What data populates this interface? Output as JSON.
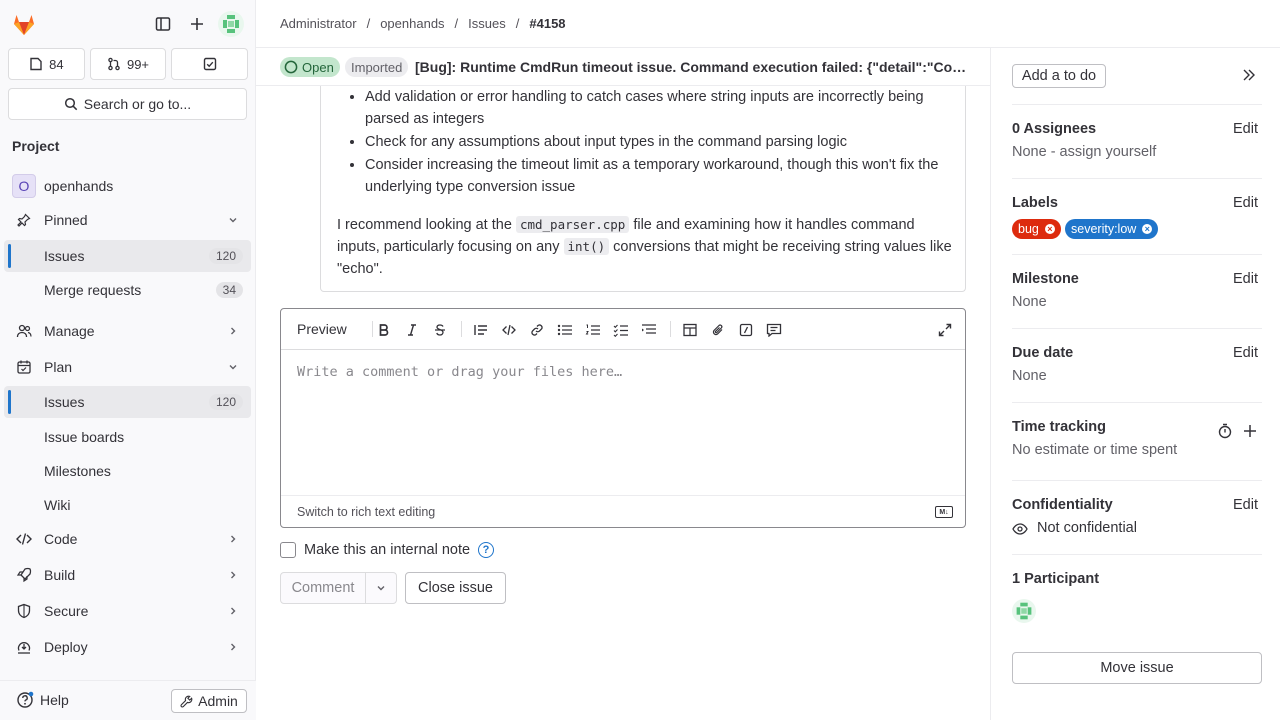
{
  "sidebar": {
    "counters": [
      {
        "icon": "issues-icon",
        "value": "84"
      },
      {
        "icon": "merge-request-icon",
        "value": "99+"
      },
      {
        "icon": "todo-icon",
        "value": ""
      }
    ],
    "search_label": "Search or go to...",
    "section_label": "Project",
    "project": {
      "avatar_letter": "O",
      "name": "openhands"
    },
    "pinned": {
      "label": "Pinned",
      "items": [
        {
          "label": "Issues",
          "count": "120"
        },
        {
          "label": "Merge requests",
          "count": "34"
        }
      ]
    },
    "manage_label": "Manage",
    "plan": {
      "label": "Plan",
      "items": [
        {
          "label": "Issues",
          "count": "120"
        },
        {
          "label": "Issue boards"
        },
        {
          "label": "Milestones"
        },
        {
          "label": "Wiki"
        }
      ]
    },
    "groups": [
      {
        "label": "Code"
      },
      {
        "label": "Build"
      },
      {
        "label": "Secure"
      },
      {
        "label": "Deploy"
      }
    ],
    "help_label": "Help",
    "admin_label": "Admin"
  },
  "breadcrumb": [
    "Administrator",
    "openhands",
    "Issues",
    "#4158"
  ],
  "issue": {
    "status": "Open",
    "imported": "Imported",
    "title": "[Bug]: Runtime CmdRun timeout issue. Command execution failed: {\"detail\":\"Command execution failed: timeout\"}"
  },
  "note": {
    "bullets": [
      "Add validation or error handling to catch cases where string inputs are incorrectly being parsed as integers",
      "Check for any assumptions about input types in the command parsing logic",
      "Consider increasing the timeout limit as a temporary workaround, though this won't fix the underlying type conversion issue"
    ],
    "para_1": "I recommend looking at the ",
    "code_1": "cmd_parser.cpp",
    "para_2": " file and examining how it handles command inputs, particularly focusing on any ",
    "code_2": "int()",
    "para_3": " conversions that might be receiving string values like \"echo\"."
  },
  "editor": {
    "preview_tab": "Preview",
    "placeholder": "Write a comment or drag your files here…",
    "switch_label": "Switch to rich text editing",
    "internal_note_label": "Make this an internal note",
    "comment_button": "Comment",
    "close_button": "Close issue"
  },
  "right_sidebar": {
    "todo_button": "Add a to do",
    "assignees": {
      "title": "0 Assignees",
      "edit": "Edit",
      "value": "None - assign yourself"
    },
    "labels": {
      "title": "Labels",
      "edit": "Edit",
      "items": [
        "bug",
        "severity:low"
      ]
    },
    "milestone": {
      "title": "Milestone",
      "edit": "Edit",
      "value": "None"
    },
    "due_date": {
      "title": "Due date",
      "edit": "Edit",
      "value": "None"
    },
    "time_tracking": {
      "title": "Time tracking",
      "value": "No estimate or time spent"
    },
    "confidentiality": {
      "title": "Confidentiality",
      "edit": "Edit",
      "value": "Not confidential"
    },
    "participants": {
      "title": "1 Participant"
    },
    "move_button": "Move issue"
  },
  "colors": {
    "accent": "#1f75cb",
    "bug_label": "#dd2b0e",
    "severity_label": "#1f75cb",
    "open_badge": "#c3e6cd"
  }
}
